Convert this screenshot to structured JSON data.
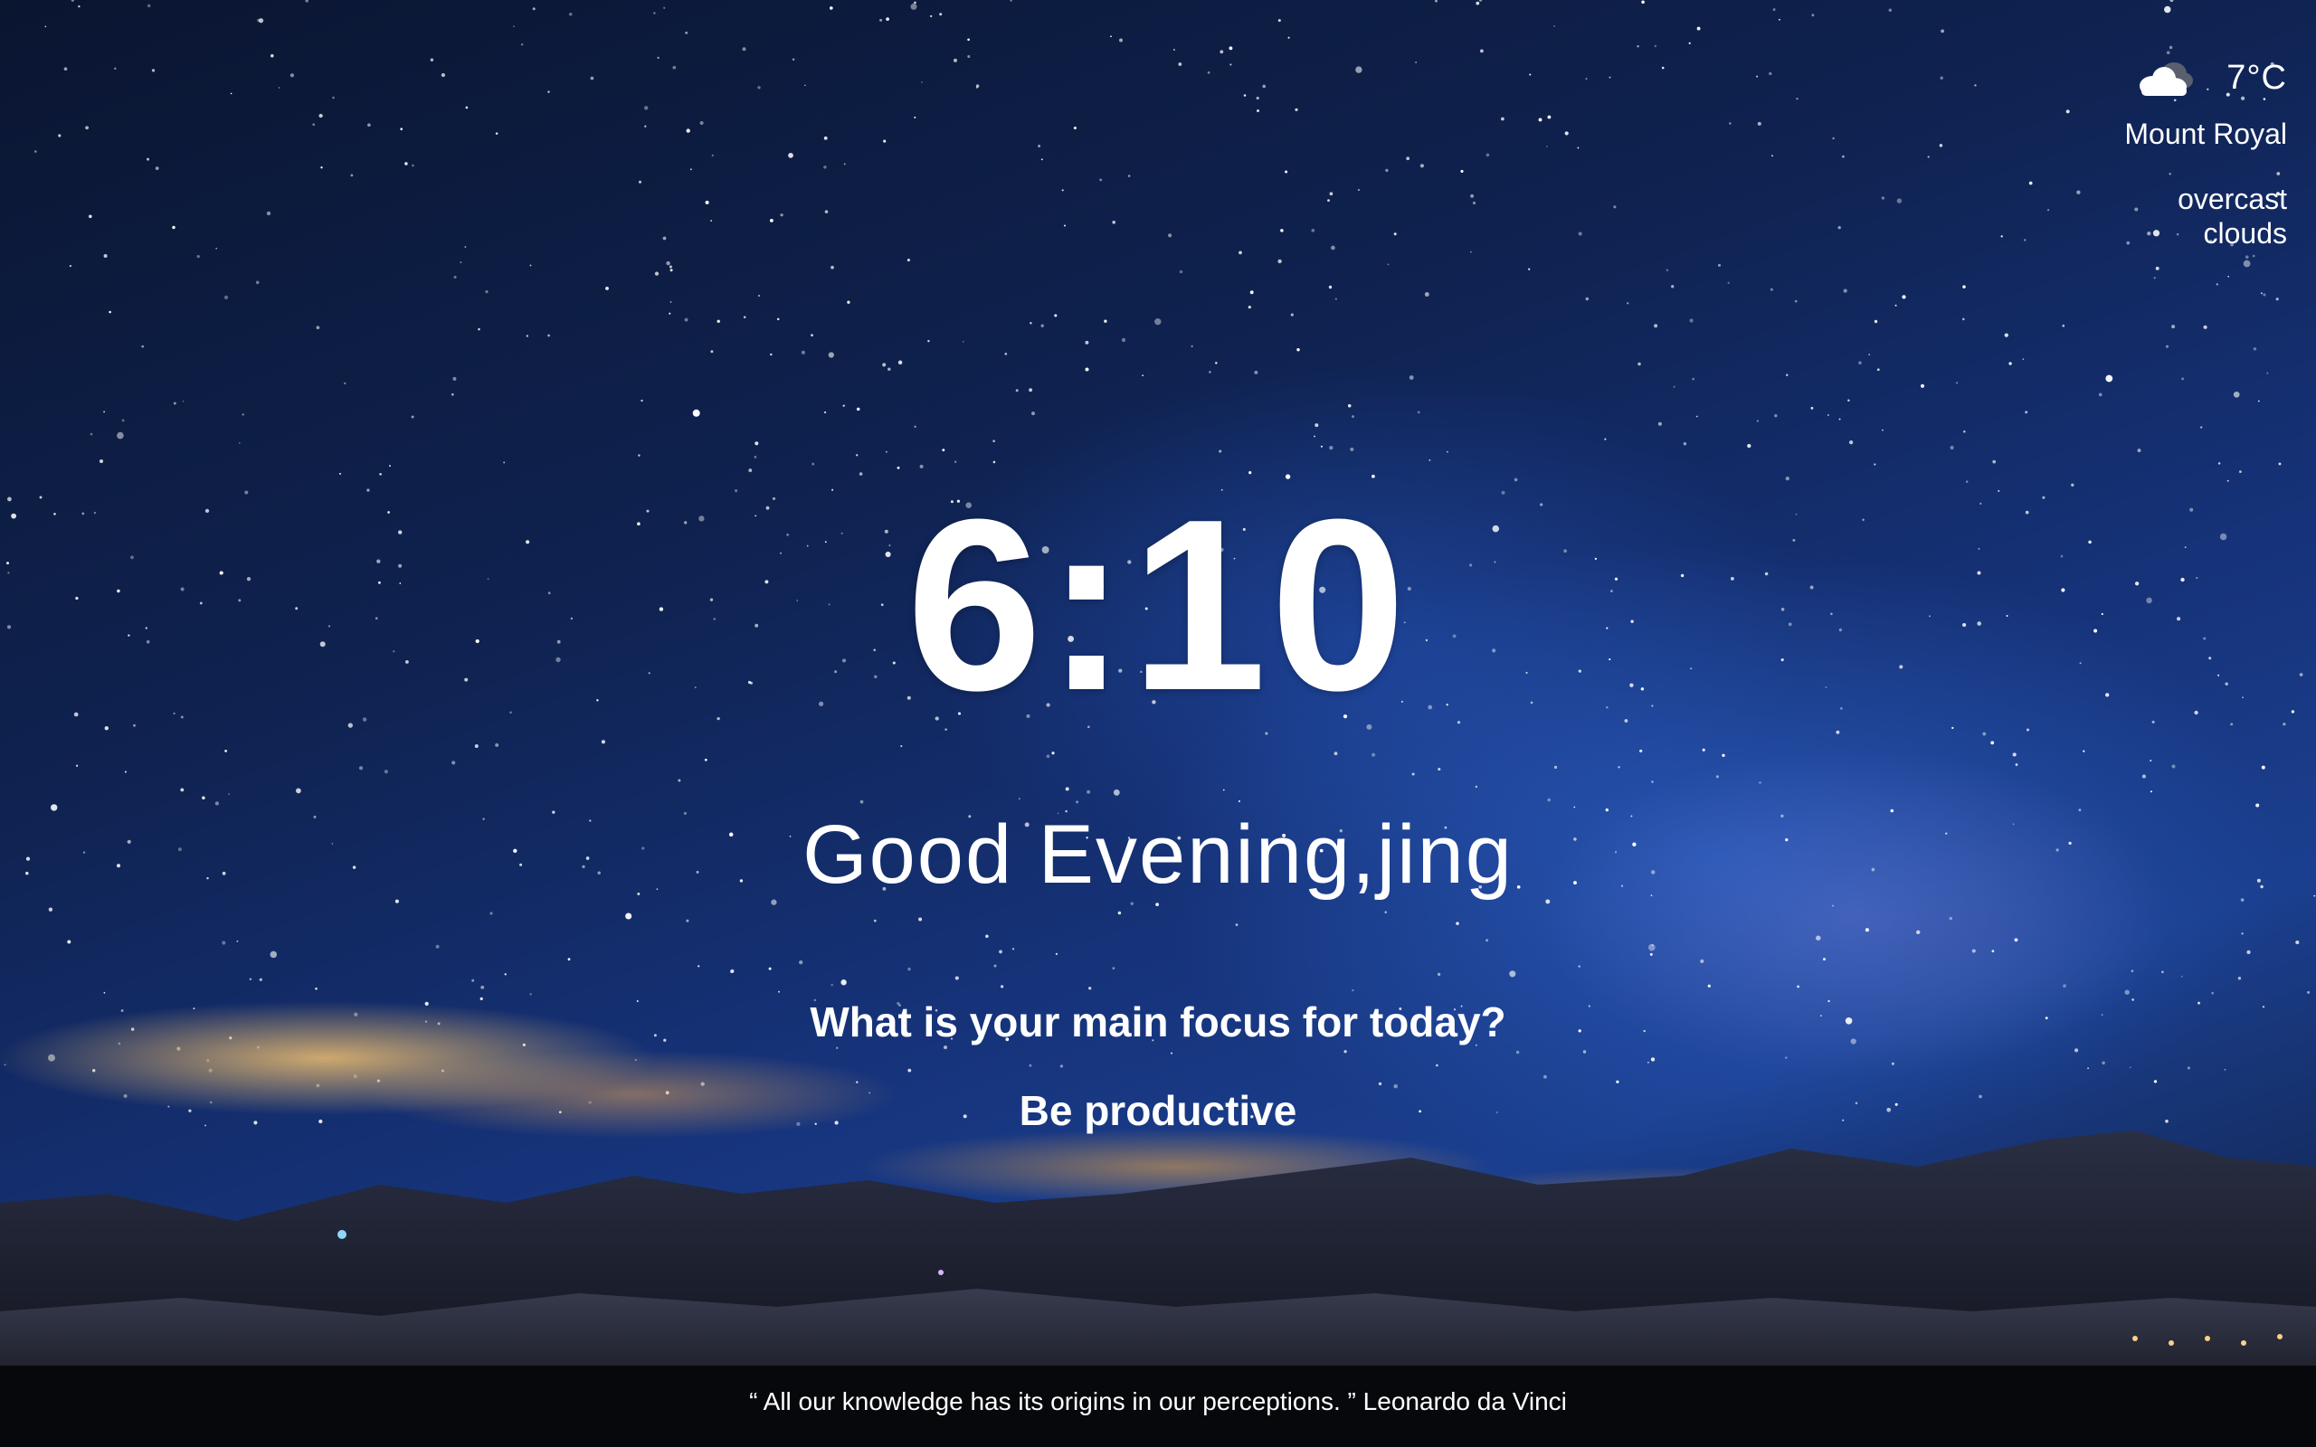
{
  "background": {
    "description": "night sky with milky way over mountains",
    "colors": {
      "sky_dark": "#0a1530",
      "sky_blue": "#1b3f8f",
      "horizon_glow": "#eebe6e"
    }
  },
  "weather": {
    "icon": "cloud-icon",
    "temperature": "7°C",
    "location": "Mount Royal",
    "description": "overcast clouds"
  },
  "clock": {
    "time": "6:10"
  },
  "greeting": {
    "text": "Good Evening,jing"
  },
  "focus": {
    "question": "What is your main focus for today?",
    "answer": "Be productive"
  },
  "quote": {
    "text": "“ All our knowledge has its origins in our perceptions. ”",
    "author": "Leonardo da Vinci"
  }
}
